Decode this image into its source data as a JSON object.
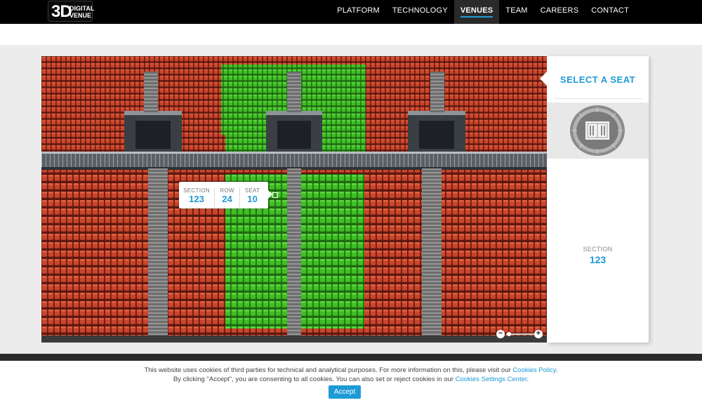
{
  "brand": {
    "logo_mark": "3D",
    "logo_line1": "DIGITAL",
    "logo_line2": "VENUE"
  },
  "nav": {
    "items": [
      {
        "label": "PLATFORM",
        "active": false
      },
      {
        "label": "TECHNOLOGY",
        "active": false
      },
      {
        "label": "VENUES",
        "active": true
      },
      {
        "label": "TEAM",
        "active": false
      },
      {
        "label": "CAREERS",
        "active": false
      },
      {
        "label": "CONTACT",
        "active": false
      }
    ]
  },
  "viewer": {
    "tooltip": {
      "section_label": "SECTION",
      "section_value": "123",
      "row_label": "ROW",
      "row_value": "24",
      "seat_label": "SEAT",
      "seat_value": "10"
    },
    "zoom": {
      "minus": "−",
      "plus": "+",
      "level": 0.1
    },
    "colors": {
      "available_seat": "#3fbf24",
      "occupied_seat": "#c9452b",
      "stairs": "#7d7d7d"
    }
  },
  "sidebar": {
    "title": "SELECT A SEAT",
    "section_label": "SECTION",
    "section_value": "123"
  },
  "cookie": {
    "line1_text": "This website uses cookies of third parties for technical and analytical purposes. For more information on this, please visit our ",
    "line1_link": "Cookies Policy",
    "line1_end": ".",
    "line2_text": "By clicking \"Accept\", you are consenting to all cookies. You can also set or reject cookies in our ",
    "line2_link": "Cookies Settings Center",
    "line2_end": ".",
    "accept_label": "Accept"
  },
  "colors": {
    "accent": "#1e9ad6",
    "nav_bg": "#000000"
  }
}
